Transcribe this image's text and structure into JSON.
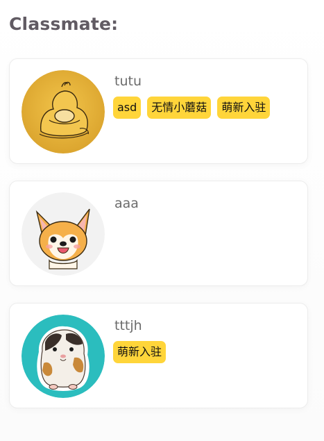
{
  "page": {
    "title": "Classmate:"
  },
  "classmates": [
    {
      "name": "tutu",
      "avatar": "psyduck-avatar",
      "tags": [
        "asd",
        "无情小蘑菇",
        "萌新入驻"
      ]
    },
    {
      "name": "aaa",
      "avatar": "corgi-avatar",
      "tags": []
    },
    {
      "name": "tttjh",
      "avatar": "guinea-pig-avatar",
      "tags": [
        "萌新入驻"
      ]
    }
  ],
  "colors": {
    "tag_background": "#ffd53a",
    "title_text": "#615b63"
  }
}
